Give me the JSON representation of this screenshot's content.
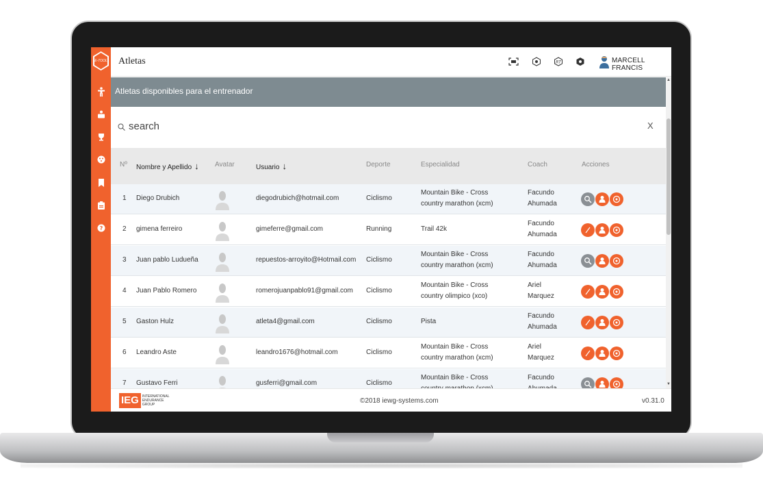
{
  "app": {
    "logo_text": "E-TOOL",
    "page_title": "Atletas",
    "user_name": "MARCELL FRANCIS"
  },
  "sidebar": {
    "items": [
      {
        "icon": "athlete-icon"
      },
      {
        "icon": "trainer-icon"
      },
      {
        "icon": "trophy-icon"
      },
      {
        "icon": "palette-icon"
      },
      {
        "icon": "bookmark-icon"
      },
      {
        "icon": "clipboard-icon"
      },
      {
        "icon": "help-icon"
      }
    ]
  },
  "section": {
    "title": "Atletas disponibles para el entrenador"
  },
  "search": {
    "placeholder": "search",
    "clear": "X"
  },
  "table": {
    "columns": {
      "num": "Nº",
      "name": "Nombre y Apellido",
      "avatar": "Avatar",
      "user": "Usuario",
      "sport": "Deporte",
      "specialty": "Especialidad",
      "coach": "Coach",
      "actions": "Acciones"
    },
    "rows": [
      {
        "num": "1",
        "name": "Diego Drubich",
        "user": "diegodrubich@hotmail.com",
        "sport": "Ciclismo",
        "specialty": "Mountain Bike - Cross country marathon (xcm)",
        "coach": "Facundo Ahumada",
        "first_action": "gray"
      },
      {
        "num": "2",
        "name": "gimena ferreiro",
        "user": "gimeferre@gmail.com",
        "sport": "Running",
        "specialty": "Trail 42k",
        "coach": "Facundo Ahumada",
        "first_action": "orange"
      },
      {
        "num": "3",
        "name": "Juan pablo Ludueña",
        "user": "repuestos-arroyito@Hotmail.com",
        "sport": "Ciclismo",
        "specialty": "Mountain Bike - Cross country marathon (xcm)",
        "coach": "Facundo Ahumada",
        "first_action": "gray"
      },
      {
        "num": "4",
        "name": "Juan Pablo Romero",
        "user": "romerojuanpablo91@gmail.com",
        "sport": "Ciclismo",
        "specialty": "Mountain Bike - Cross country olimpico (xco)",
        "coach": "Ariel Marquez",
        "first_action": "orange"
      },
      {
        "num": "5",
        "name": "Gaston Hulz",
        "user": "atleta4@gmail.com",
        "sport": "Ciclismo",
        "specialty": "Pista",
        "coach": "Facundo Ahumada",
        "first_action": "orange"
      },
      {
        "num": "6",
        "name": "Leandro Aste",
        "user": "leandro1676@hotmail.com",
        "sport": "Ciclismo",
        "specialty": "Mountain Bike - Cross country marathon (xcm)",
        "coach": "Ariel Marquez",
        "first_action": "orange"
      },
      {
        "num": "7",
        "name": "Gustavo Ferri",
        "user": "gusferri@gmail.com",
        "sport": "Ciclismo",
        "specialty": "Mountain Bike - Cross country marathon (xcm)",
        "coach": "Facundo Ahumada",
        "first_action": "gray"
      }
    ]
  },
  "footer": {
    "logo": "IEG",
    "logo_sub": [
      "INTERNATIONAL",
      "ENDURANCE",
      "GROUP"
    ],
    "copyright": "©2018 iewg-systems.com",
    "version": "v0.31.0"
  },
  "colors": {
    "accent": "#f0622d",
    "header_gray": "#7e8b91",
    "action_gray": "#8a8f94"
  }
}
